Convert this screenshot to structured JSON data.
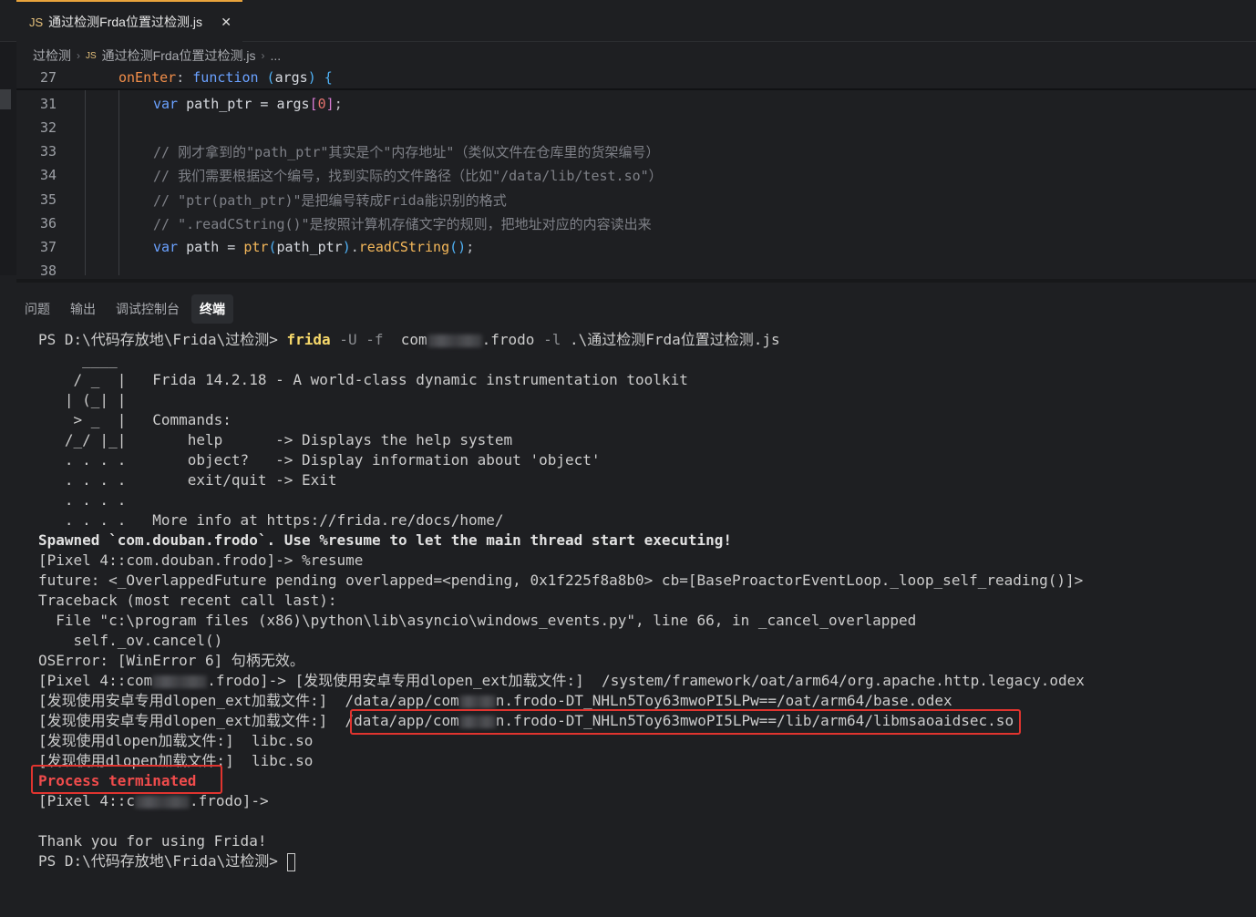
{
  "tab": {
    "icon_label": "JS",
    "title": "通过检测Frda位置过检测.js",
    "close": "✕"
  },
  "breadcrumb": {
    "folder": "过检测",
    "file_icon": "JS",
    "file": "通过检测Frda位置过检测.js",
    "more": "..."
  },
  "editor": {
    "lines": [
      {
        "n": "27",
        "onEnter": "onEnter",
        "colon": ": ",
        "function": "function",
        "open": " (",
        "args": "args",
        "close": ") ",
        "brace": "{"
      },
      {
        "n": "31",
        "var": "var",
        "name": " path_ptr = ",
        "args": "args",
        "ob": "[",
        "idx": "0",
        "cb": "]",
        "semi": ";"
      },
      {
        "n": "32"
      },
      {
        "n": "33",
        "comment": "// 刚才拿到的\"path_ptr\"其实是个\"内存地址\"（类似文件在仓库里的货架编号）"
      },
      {
        "n": "34",
        "comment": "// 我们需要根据这个编号，找到实际的文件路径（比如\"/data/lib/test.so\"）"
      },
      {
        "n": "35",
        "comment": "// \"ptr(path_ptr)\"是把编号转成Frida能识别的格式"
      },
      {
        "n": "36",
        "comment": "// \".readCString()\"是按照计算机存储文字的规则，把地址对应的内容读出来"
      },
      {
        "n": "37",
        "var": "var",
        "name": " path = ",
        "ptr": "ptr",
        "ob": "(",
        "arg": "path_ptr",
        "cb": ")",
        "dot": ".",
        "read": "readCString",
        "call": "()",
        "semi": ";"
      },
      {
        "n": "38"
      }
    ]
  },
  "panel": {
    "tabs": [
      "问题",
      "输出",
      "调试控制台",
      "终端"
    ],
    "active_tab": "终端"
  },
  "terminal": {
    "l01": {
      "prompt": "PS D:\\代码存放地\\Frida\\过检测> ",
      "cmd": "frida",
      "flags": " -U -f ",
      "pkg_a": " com",
      "pkg_b": ".frodo",
      "flag_l": " -l ",
      "script": ".\\通过检测Frda位置过检测.js"
    },
    "l02": "     ____",
    "l03": "    / _  |   Frida 14.2.18 - A world-class dynamic instrumentation toolkit",
    "l04": "   | (_| |",
    "l05": "    > _  |   Commands:",
    "l06": "   /_/ |_|       help      -> Displays the help system",
    "l07": "   . . . .       object?   -> Display information about 'object'",
    "l08": "   . . . .       exit/quit -> Exit",
    "l09": "   . . . .",
    "l10": "   . . . .   More info at https://frida.re/docs/home/",
    "l11": "Spawned `com.douban.frodo`. Use %resume to let the main thread start executing!",
    "l12": "[Pixel 4::com.douban.frodo]-> %resume",
    "l13": "future: <_OverlappedFuture pending overlapped=<pending, 0x1f225f8a8b0> cb=[BaseProactorEventLoop._loop_self_reading()]>",
    "l14": "Traceback (most recent call last):",
    "l15": "  File \"c:\\program files (x86)\\python\\lib\\asyncio\\windows_events.py\", line 66, in _cancel_overlapped",
    "l16": "    self._ov.cancel()",
    "l17": "OSError: [WinError 6] 句柄无效。",
    "l18": {
      "a": "[Pixel 4::com",
      "b": ".frodo]-> [发现使用安卓专用dlopen_ext加载文件:]  /system/framework/oat/arm64/org.apache.http.legacy.odex"
    },
    "l19": {
      "a": "[发现使用安卓专用dlopen_ext加载文件:]  /data/app/com",
      "b": "n.frodo-DT_NHLn5Toy63mwoPI5LPw==/oat/arm64/base.odex"
    },
    "l20": {
      "a": "[发现使用安卓专用dlopen_ext加载文件:]  /data/app/com",
      "b": "n.frodo-DT_NHLn5Toy63mwoPI5LPw==/lib/arm64/libmsaoaidsec.so"
    },
    "l21": "[发现使用dlopen加载文件:]  libc.so",
    "l22": "[发现使用dlopen加载文件:]  libc.so",
    "l23": "Process terminated",
    "l24": {
      "a": "[Pixel 4::c",
      "b": ".frodo]->"
    },
    "l25": "Thank you for using Frida!",
    "l26": "PS D:\\代码存放地\\Frida\\过检测> "
  },
  "colors": {
    "accent": "#e8a33c",
    "highlight_box": "#e0342f",
    "error_text": "#f14c4c"
  }
}
